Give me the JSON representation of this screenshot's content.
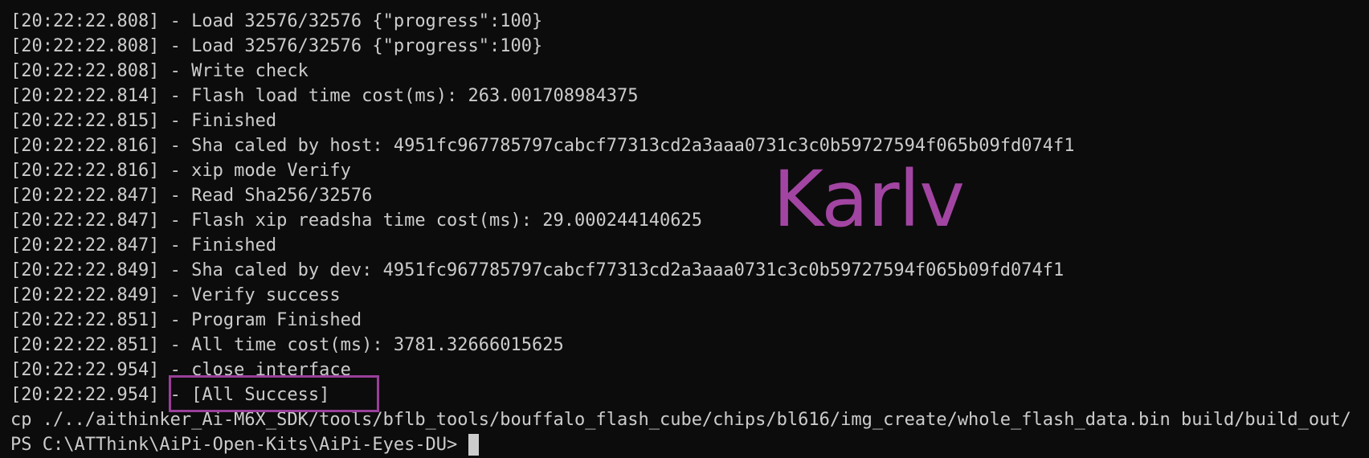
{
  "terminal": {
    "lines": [
      "[20:22:22.808] - Load 32576/32576 {\"progress\":100}",
      "[20:22:22.808] - Load 32576/32576 {\"progress\":100}",
      "[20:22:22.808] - Write check",
      "[20:22:22.814] - Flash load time cost(ms): 263.001708984375",
      "[20:22:22.815] - Finished",
      "[20:22:22.816] - Sha caled by host: 4951fc967785797cabcf77313cd2a3aaa0731c3c0b59727594f065b09fd074f1",
      "[20:22:22.816] - xip mode Verify",
      "[20:22:22.847] - Read Sha256/32576",
      "[20:22:22.847] - Flash xip readsha time cost(ms): 29.000244140625",
      "[20:22:22.847] - Finished",
      "[20:22:22.849] - Sha caled by dev: 4951fc967785797cabcf77313cd2a3aaa0731c3c0b59727594f065b09fd074f1",
      "[20:22:22.849] - Verify success",
      "[20:22:22.851] - Program Finished",
      "[20:22:22.851] - All time cost(ms): 3781.32666015625",
      "[20:22:22.954] - close interface",
      "[20:22:22.954] - [All Success]",
      "cp ./../aithinker_Ai-M6X_SDK/tools/bflb_tools/bouffalo_flash_cube/chips/bl616/img_create/whole_flash_data.bin build/build_out/"
    ],
    "prompt": "PS C:\\ATThink\\AiPi-Open-Kits\\AiPi-Eyes-DU>"
  },
  "watermark": "Karlv",
  "colors": {
    "background": "#0c0c0c",
    "text": "#cccccc",
    "annotation": "#9a3f9a",
    "watermark": "#a245a2"
  }
}
